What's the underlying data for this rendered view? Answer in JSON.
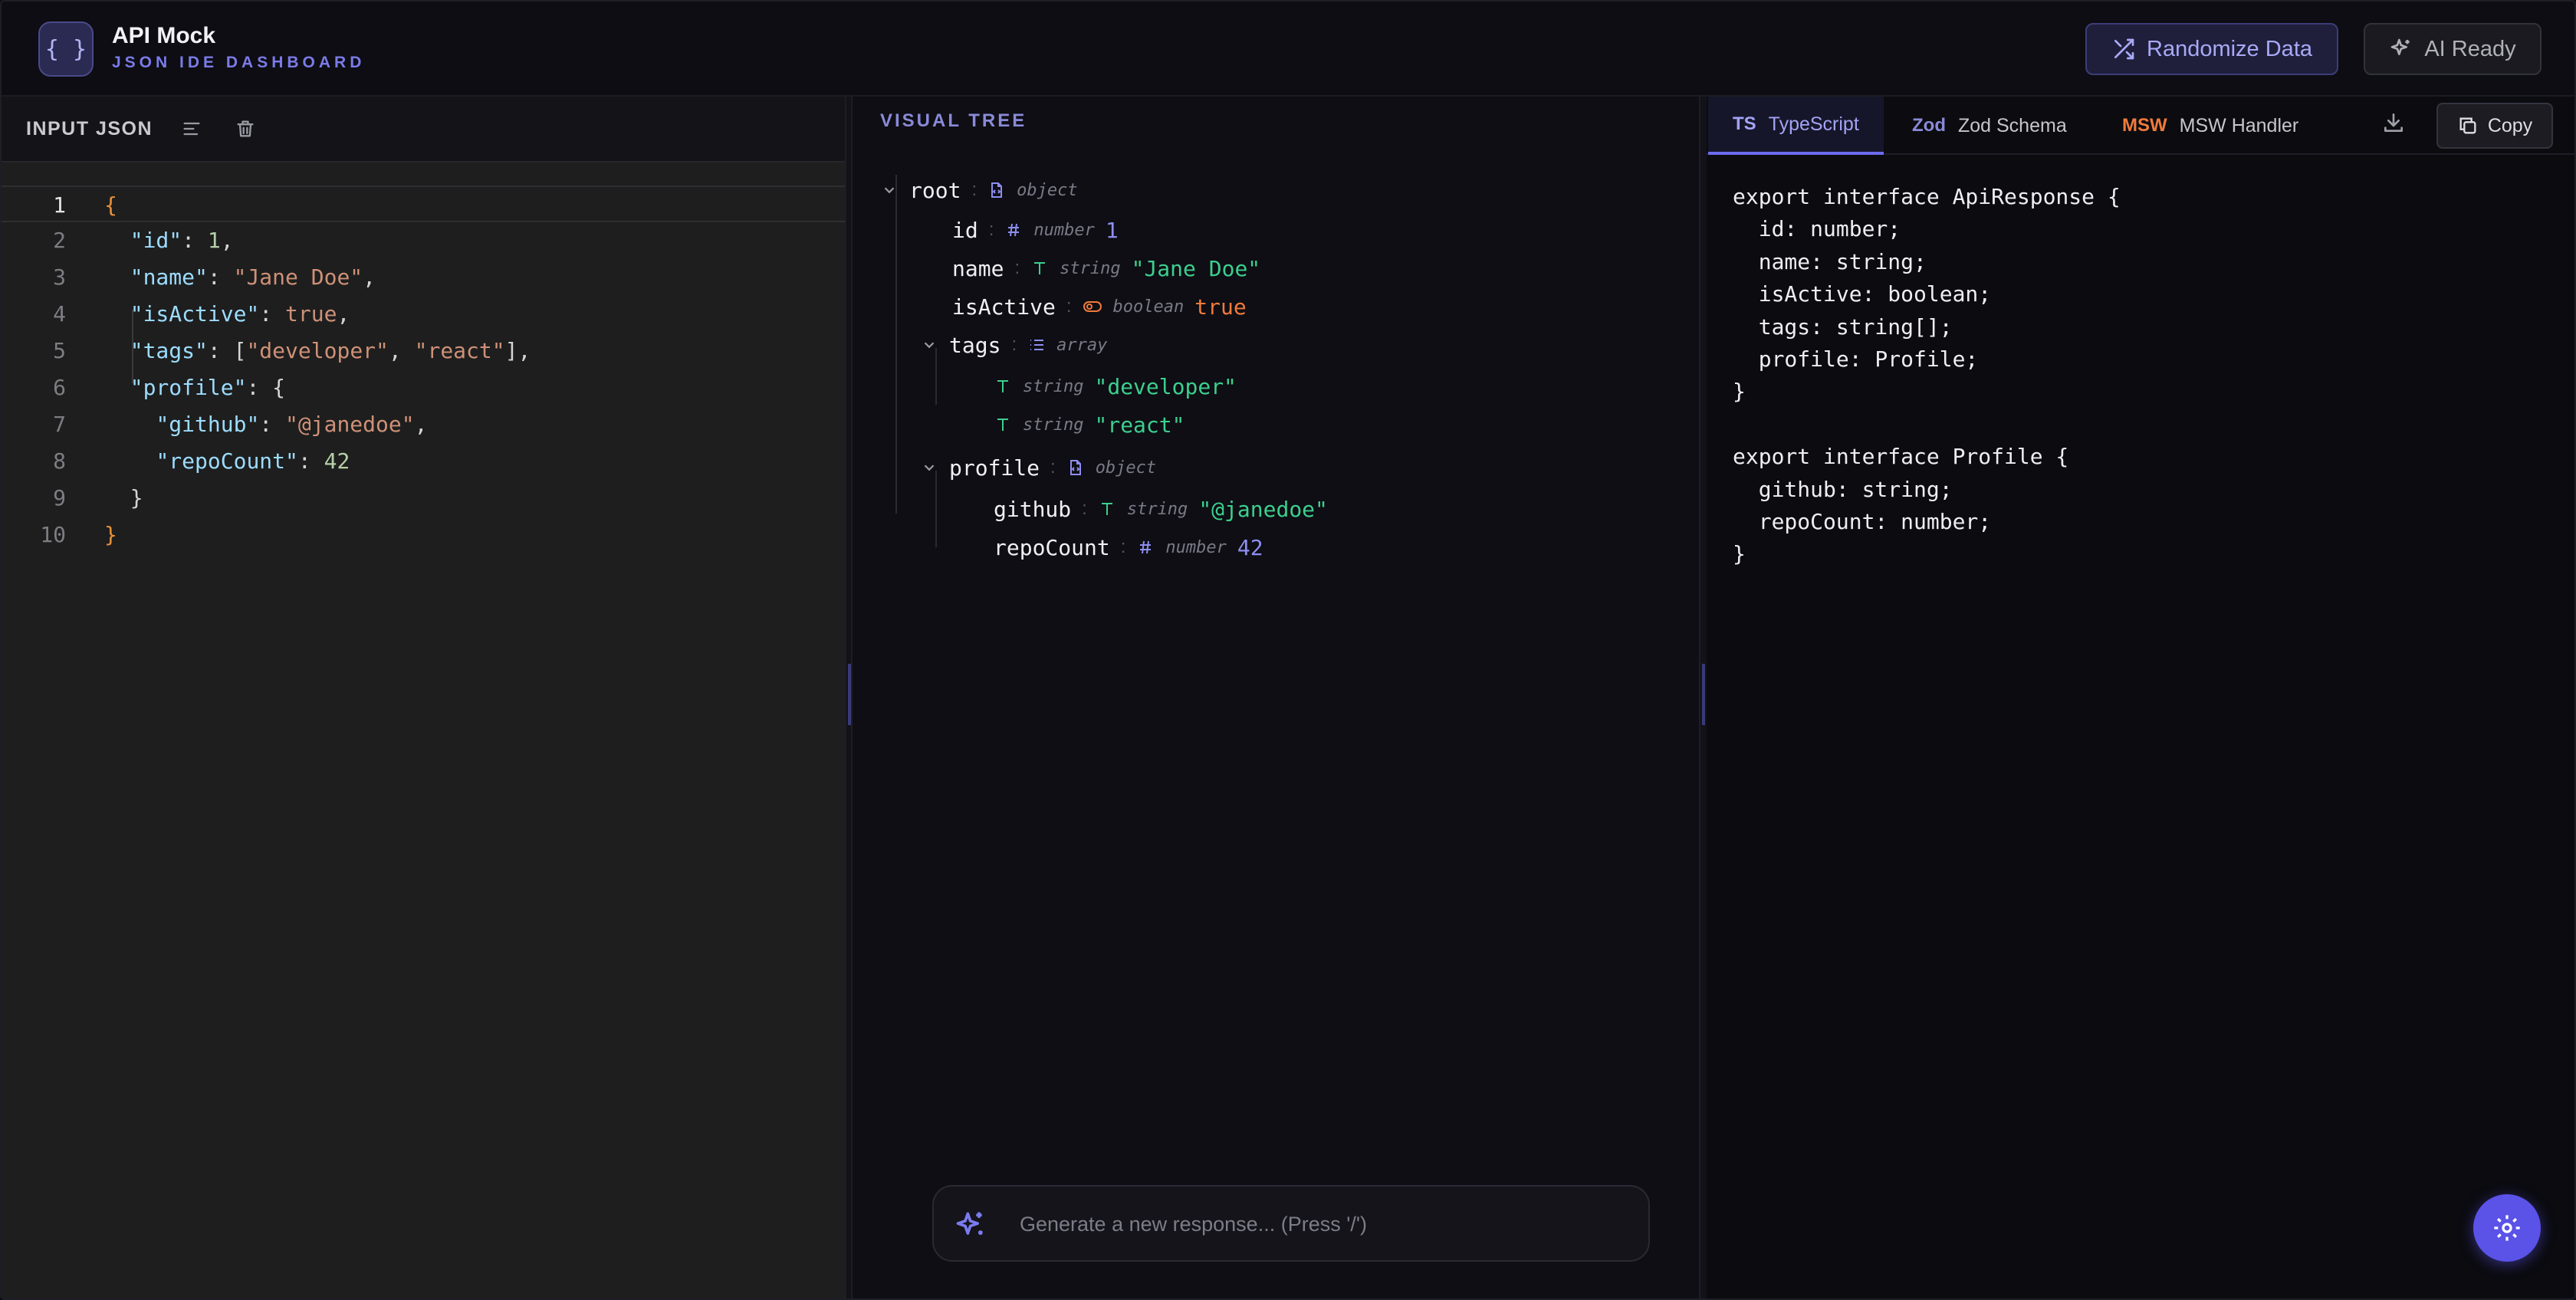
{
  "header": {
    "logo_glyph": "{ }",
    "title": "API Mock",
    "subtitle": "JSON IDE DASHBOARD",
    "randomize_label": "Randomize Data",
    "ai_label": "AI Ready"
  },
  "left": {
    "title": "INPUT JSON",
    "line_numbers": [
      "1",
      "2",
      "3",
      "4",
      "5",
      "6",
      "7",
      "8",
      "9",
      "10"
    ]
  },
  "tree": {
    "title": "VISUAL TREE",
    "root_key": "root",
    "root_type": "object",
    "id_key": "id",
    "id_type": "number",
    "id_value": "1",
    "name_key": "name",
    "name_type": "string",
    "name_value": "\"Jane Doe\"",
    "active_key": "isActive",
    "active_type": "boolean",
    "active_value": "true",
    "tags_key": "tags",
    "tags_type": "array",
    "tag1_type": "string",
    "tag1_value": "\"developer\"",
    "tag2_type": "string",
    "tag2_value": "\"react\"",
    "profile_key": "profile",
    "profile_type": "object",
    "github_key": "github",
    "github_type": "string",
    "github_value": "\"@janedoe\"",
    "repo_key": "repoCount",
    "repo_type": "number",
    "repo_value": "42",
    "colon": ":"
  },
  "generate": {
    "placeholder": "Generate a new response... (Press '/')"
  },
  "right": {
    "tabs": [
      {
        "prefix": "TS",
        "label": "TypeScript",
        "prefix_color": "#a3a3f5"
      },
      {
        "prefix": "Zod",
        "label": "Zod Schema",
        "prefix_color": "#8a8ad8"
      },
      {
        "prefix": "MSW",
        "label": "MSW Handler",
        "prefix_color": "#f07a3a"
      }
    ],
    "copy_label": "Copy",
    "code": "export interface ApiResponse {\n  id: number;\n  name: string;\n  isActive: boolean;\n  tags: string[];\n  profile: Profile;\n}\n\nexport interface Profile {\n  github: string;\n  repoCount: number;\n}"
  },
  "json_source": {
    "l1": "{",
    "l2": [
      "\"id\"",
      ": ",
      "1",
      ","
    ],
    "l3": [
      "\"name\"",
      ": ",
      "\"Jane Doe\"",
      ","
    ],
    "l4": [
      "\"isActive\"",
      ": ",
      "true",
      ","
    ],
    "l5": [
      "\"tags\"",
      ": [",
      "\"developer\"",
      ", ",
      "\"react\"",
      "],"
    ],
    "l6": [
      "\"profile\"",
      ": {"
    ],
    "l7": [
      "\"github\"",
      ": ",
      "\"@janedoe\"",
      ","
    ],
    "l8": [
      "\"repoCount\"",
      ": ",
      "42"
    ],
    "l9": "}",
    "l10": "}"
  }
}
